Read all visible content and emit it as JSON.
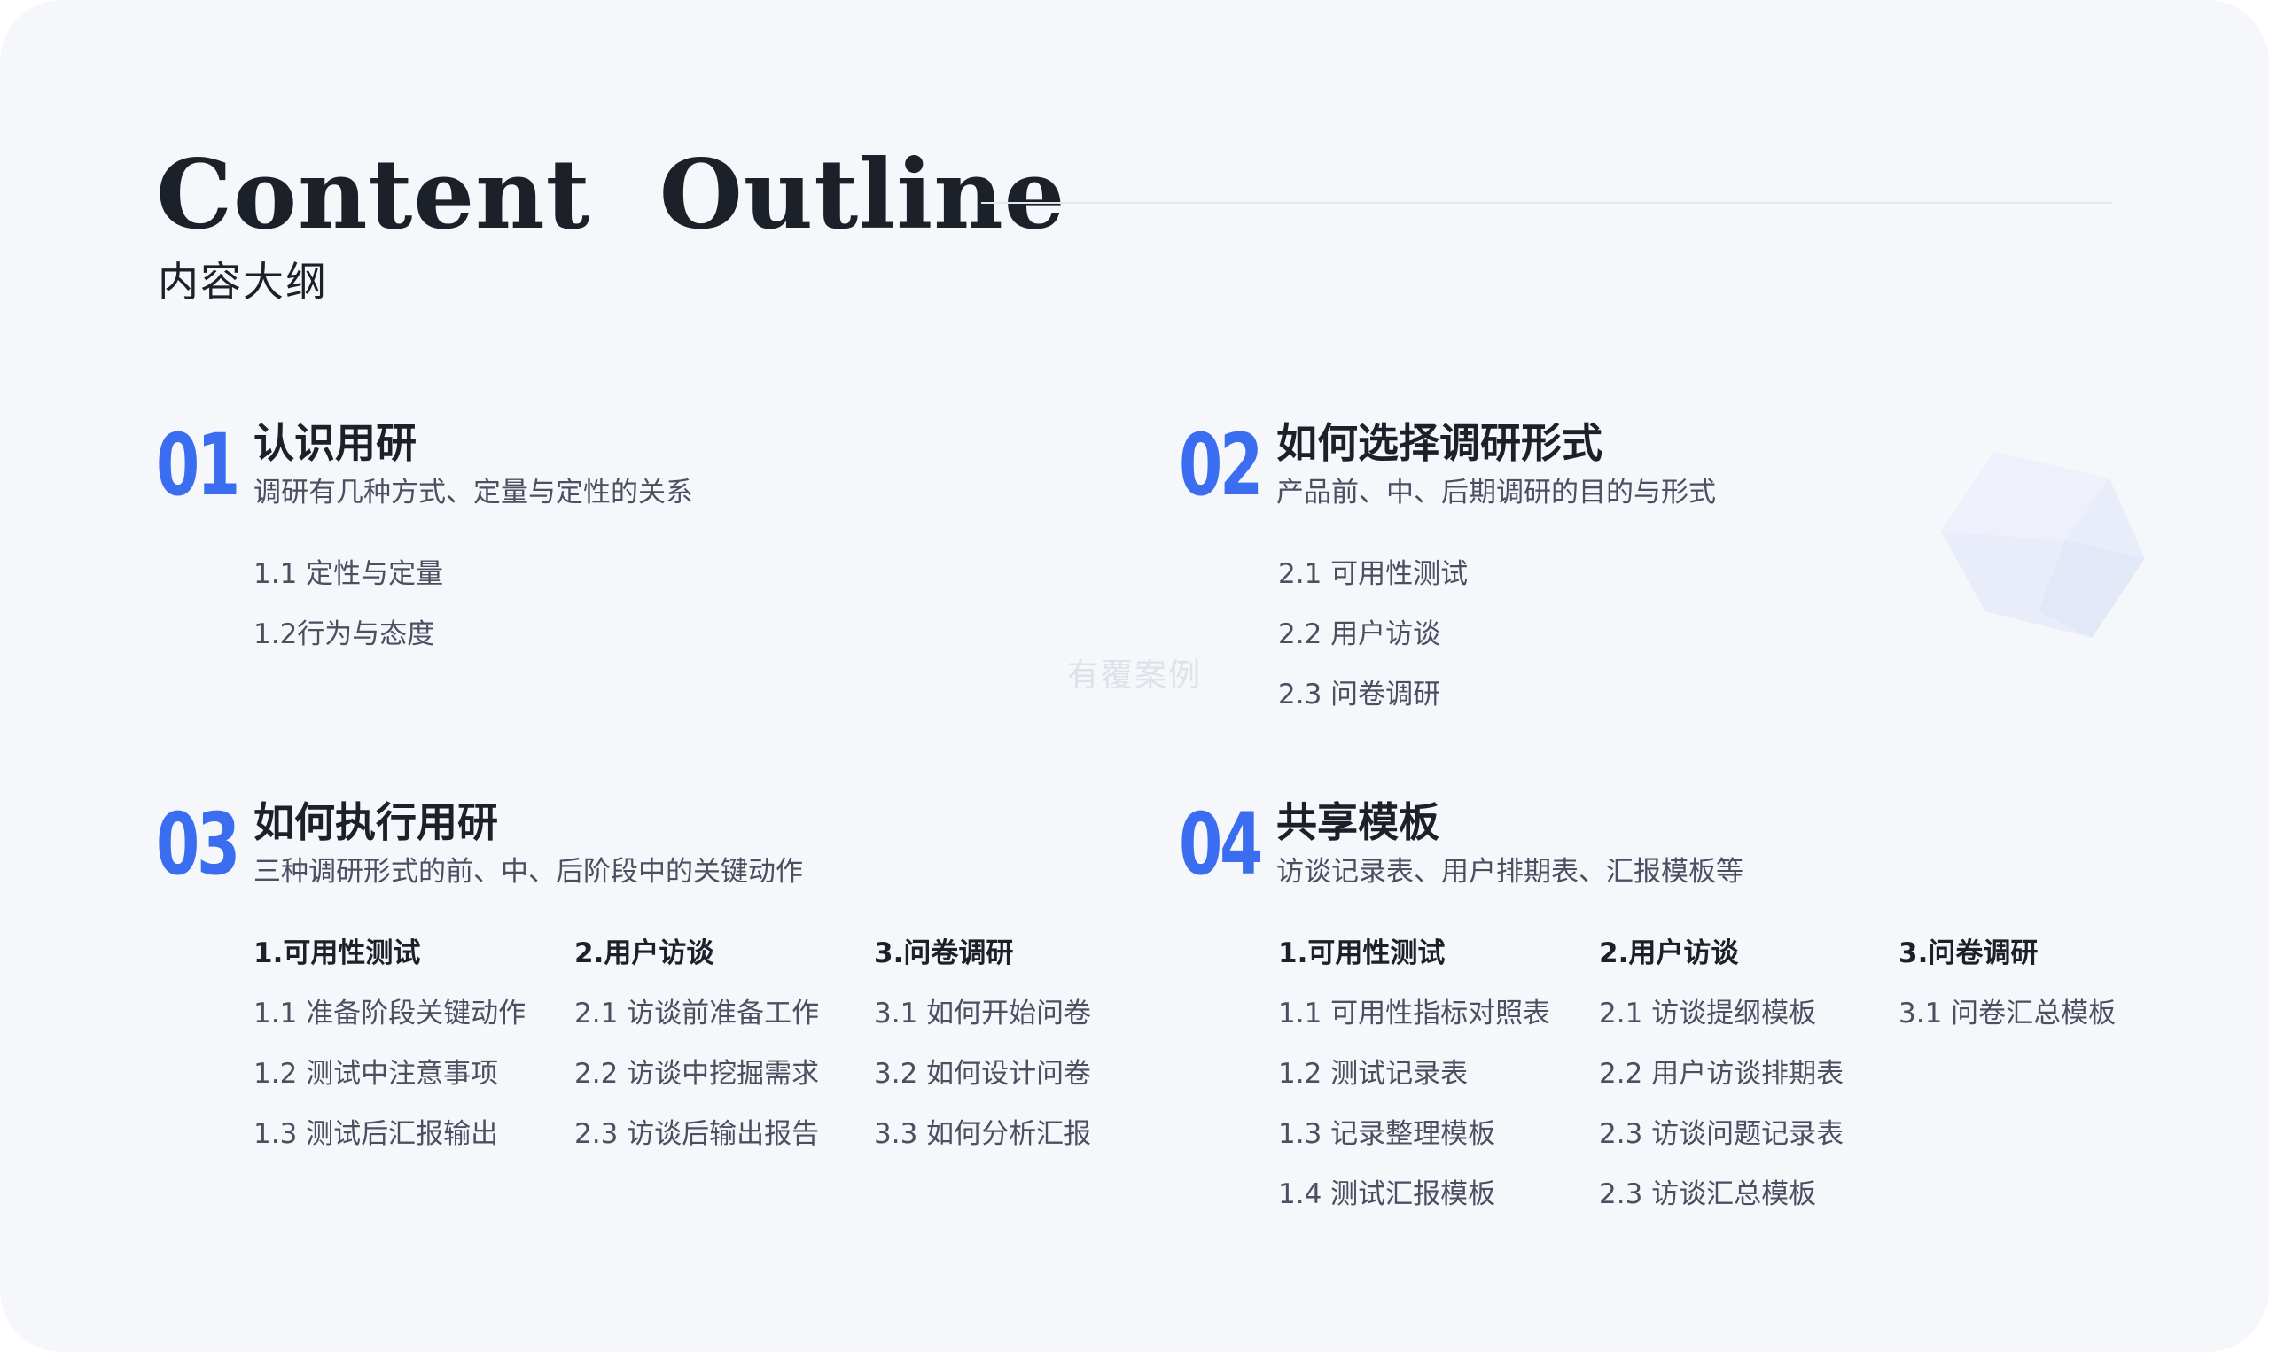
{
  "header": {
    "title_en": "Content  Outline",
    "title_cn": "内容大纲"
  },
  "watermark": "有覆案例",
  "decoration": {
    "icon": "cube-icon",
    "color": "#e8ecf8"
  },
  "accent_color": "#3a6df0",
  "sections": [
    {
      "number": "01",
      "title": "认识用研",
      "subtitle": "调研有几种方式、定量与定性的关系",
      "items": [
        "1.1 定性与定量",
        "1.2行为与态度"
      ]
    },
    {
      "number": "02",
      "title": "如何选择调研形式",
      "subtitle": "产品前、中、后期调研的目的与形式",
      "items": [
        "2.1 可用性测试",
        "2.2 用户访谈",
        "2.3 问卷调研"
      ]
    },
    {
      "number": "03",
      "title": "如何执行用研",
      "subtitle": "三种调研形式的前、中、后阶段中的关键动作",
      "columns": [
        {
          "heading": "1.可用性测试",
          "items": [
            "1.1 准备阶段关键动作",
            "1.2 测试中注意事项",
            "1.3 测试后汇报输出"
          ]
        },
        {
          "heading": "2.用户访谈",
          "items": [
            "2.1 访谈前准备工作",
            "2.2 访谈中挖掘需求",
            "2.3 访谈后输出报告"
          ]
        },
        {
          "heading": "3.问卷调研",
          "items": [
            "3.1 如何开始问卷",
            "3.2 如何设计问卷",
            "3.3 如何分析汇报"
          ]
        }
      ]
    },
    {
      "number": "04",
      "title": "共享模板",
      "subtitle": "访谈记录表、用户排期表、汇报模板等",
      "columns": [
        {
          "heading": "1.可用性测试",
          "items": [
            "1.1 可用性指标对照表",
            "1.2 测试记录表",
            "1.3 记录整理模板",
            "1.4 测试汇报模板"
          ]
        },
        {
          "heading": "2.用户访谈",
          "items": [
            "2.1 访谈提纲模板",
            "2.2 用户访谈排期表",
            "2.3 访谈问题记录表",
            "2.3 访谈汇总模板"
          ]
        },
        {
          "heading": "3.问卷调研",
          "items": [
            "3.1 问卷汇总模板"
          ]
        }
      ]
    }
  ]
}
